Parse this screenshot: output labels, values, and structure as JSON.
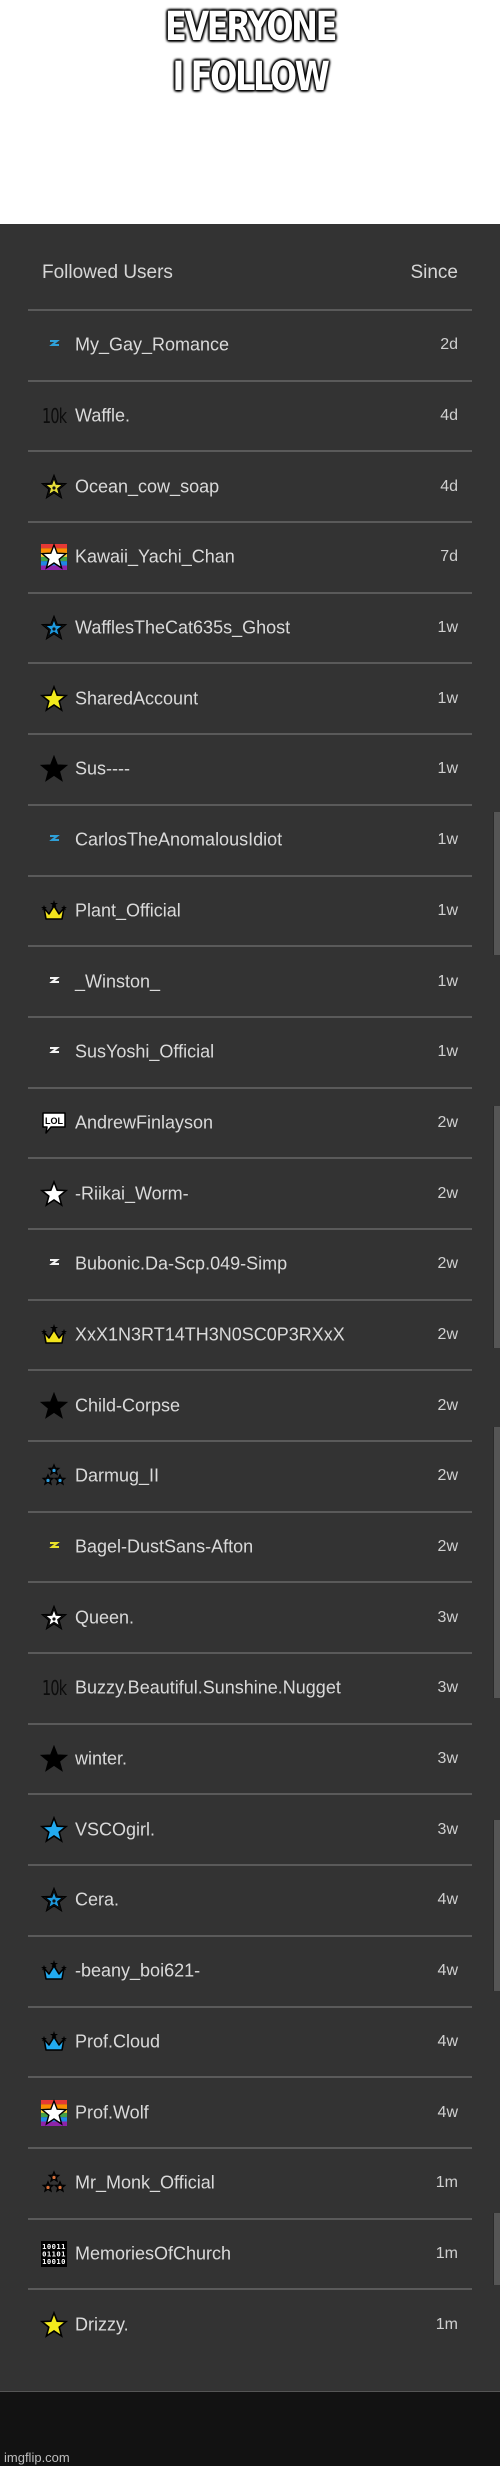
{
  "caption": {
    "lines": [
      "EVERYONE",
      "I FOLLOW"
    ]
  },
  "panel": {
    "header": {
      "title": "Followed Users",
      "since_label": "Since"
    },
    "users": [
      {
        "name": "My_Gay_Romance",
        "since": "2d",
        "icon": "bolt-icon",
        "icon_color": "#2fa0d8"
      },
      {
        "name": "Waffle.",
        "since": "4d",
        "icon": "10k-icon",
        "icon_text": "10k"
      },
      {
        "name": "Ocean_cow_soap",
        "since": "4d",
        "icon": "star-outline-icon",
        "icon_color": "#e8df3a"
      },
      {
        "name": "Kawaii_Yachi_Chan",
        "since": "7d",
        "icon": "rainbow-star-icon",
        "icon_color": "#ffffff"
      },
      {
        "name": "WafflesTheCat635s_Ghost",
        "since": "1w",
        "icon": "star-outline-icon",
        "icon_color": "#1e9be0"
      },
      {
        "name": "SharedAccount",
        "since": "1w",
        "icon": "star-icon",
        "icon_color": "#f2ea1c"
      },
      {
        "name": "Sus----",
        "since": "1w",
        "icon": "star-icon",
        "icon_color": "#000000"
      },
      {
        "name": "CarlosTheAnomalousIdiot",
        "since": "1w",
        "icon": "bolt-icon",
        "icon_color": "#2fa0d8"
      },
      {
        "name": "Plant_Official",
        "since": "1w",
        "icon": "crown-icon",
        "icon_color": "#f2e41c"
      },
      {
        "name": "_Winston_",
        "since": "1w",
        "icon": "bolt-icon",
        "icon_color": "#f2f2f2"
      },
      {
        "name": "SusYoshi_Official",
        "since": "1w",
        "icon": "bolt-icon",
        "icon_color": "#f2f2f2"
      },
      {
        "name": "AndrewFinlayson",
        "since": "2w",
        "icon": "lol-bubble-icon",
        "icon_text": "LOL"
      },
      {
        "name": "-Riikai_Worm-",
        "since": "2w",
        "icon": "star-icon",
        "icon_color": "#ffffff"
      },
      {
        "name": "Bubonic.Da-Scp.049-Simp",
        "since": "2w",
        "icon": "bolt-icon",
        "icon_color": "#f2f2f2"
      },
      {
        "name": "XxX1N3RT14TH3N0SC0P3RXxX",
        "since": "2w",
        "icon": "crown-icon",
        "icon_color": "#f2e41c"
      },
      {
        "name": "Child-Corpse",
        "since": "2w",
        "icon": "star-icon",
        "icon_color": "#000000"
      },
      {
        "name": "Darmug_II",
        "since": "2w",
        "icon": "triple-star-icon",
        "icon_color": "#2fa0e0"
      },
      {
        "name": "Bagel-DustSans-Afton",
        "since": "2w",
        "icon": "bolt-icon",
        "icon_color": "#e8df2a"
      },
      {
        "name": "Queen.",
        "since": "3w",
        "icon": "star-outline-icon",
        "icon_color": "#ffffff"
      },
      {
        "name": "Buzzy.Beautiful.Sunshine.Nugget",
        "since": "3w",
        "icon": "10k-icon",
        "icon_text": "10k"
      },
      {
        "name": "winter.",
        "since": "3w",
        "icon": "star-icon",
        "icon_color": "#000000"
      },
      {
        "name": "VSCOgirl.",
        "since": "3w",
        "icon": "star-icon",
        "icon_color": "#22aaf0"
      },
      {
        "name": "Cera.",
        "since": "4w",
        "icon": "star-outline-icon",
        "icon_color": "#1e9be0"
      },
      {
        "name": "-beany_boi621-",
        "since": "4w",
        "icon": "crown-icon",
        "icon_color": "#22aaf0"
      },
      {
        "name": "Prof.Cloud",
        "since": "4w",
        "icon": "crown-icon",
        "icon_color": "#22aaf0"
      },
      {
        "name": "Prof.Wolf",
        "since": "4w",
        "icon": "rainbow-star-icon",
        "icon_color": "#ffffff"
      },
      {
        "name": "Mr_Monk_Official",
        "since": "1m",
        "icon": "triple-star-icon",
        "icon_color": "#d8703a"
      },
      {
        "name": "MemoriesOfChurch",
        "since": "1m",
        "icon": "binary-icon",
        "icon_text": "10011 01101 10010"
      },
      {
        "name": "Drizzy.",
        "since": "1m",
        "icon": "star-icon",
        "icon_color": "#f2ea1c"
      }
    ]
  },
  "watermark": "imgflip.com"
}
